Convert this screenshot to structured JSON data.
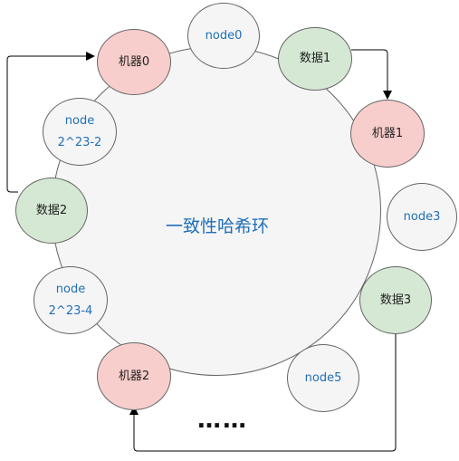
{
  "diagram": {
    "title": "一致性哈希环",
    "ellipsis": "……",
    "colors": {
      "ring_fill": "#f5f5f5",
      "machine_fill": "#f8cecc",
      "data_fill": "#d5e8d4",
      "plain_text": "#1f6fb8",
      "edge": "#000000"
    },
    "nodes": {
      "node0": {
        "label": "node0"
      },
      "data1": {
        "label": "数据1"
      },
      "machine1": {
        "label": "机器1"
      },
      "node3": {
        "label": "node3"
      },
      "data3": {
        "label": "数据3"
      },
      "node5": {
        "label": "node5"
      },
      "machine2": {
        "label": "机器2"
      },
      "node_n4": {
        "line1": "node",
        "line2": "2^23-4"
      },
      "data2": {
        "label": "数据2"
      },
      "node_n2": {
        "line1": "node",
        "line2": "2^23-2"
      },
      "machine0": {
        "label": "机器0"
      }
    },
    "edges": [
      {
        "from": "数据1",
        "to": "机器1"
      },
      {
        "from": "数据2",
        "to": "机器0"
      },
      {
        "from": "数据3",
        "to": "机器2"
      }
    ]
  }
}
